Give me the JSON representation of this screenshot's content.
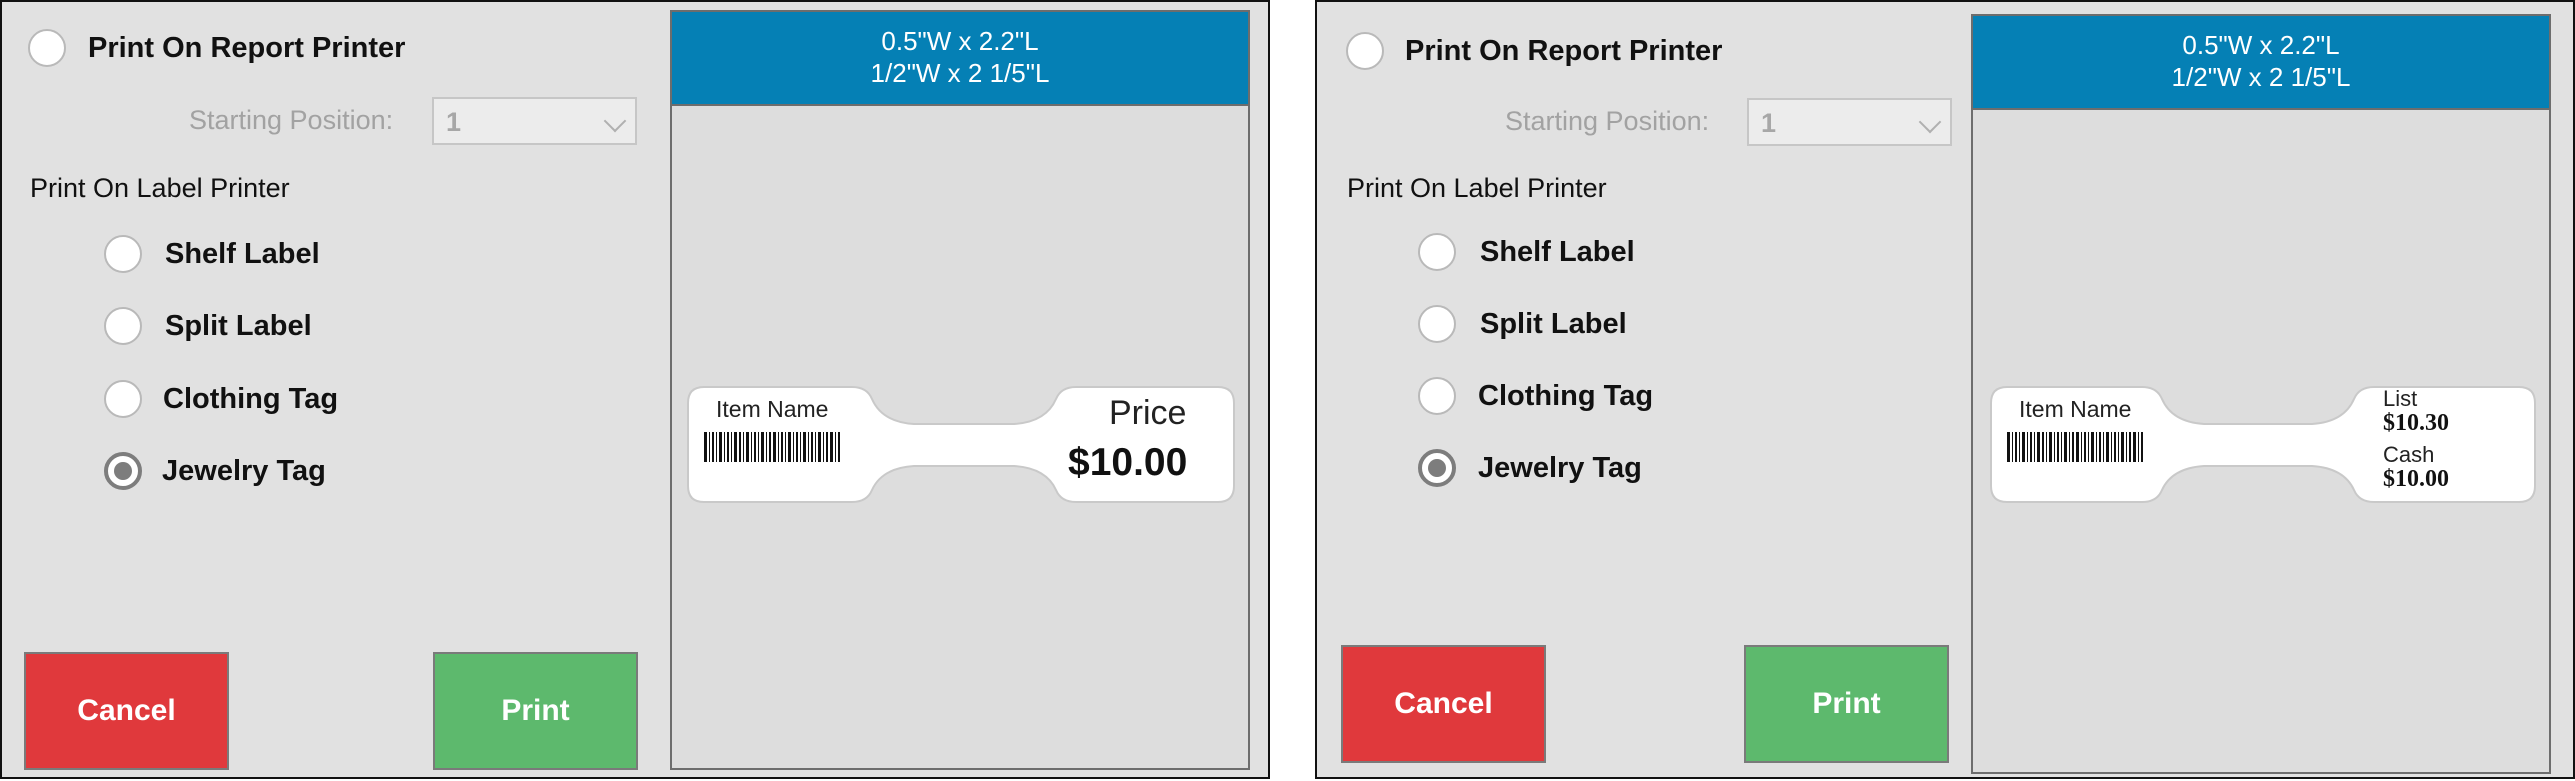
{
  "panels": [
    {
      "report_printer_label": "Print On Report Printer",
      "starting_position_label": "Starting Position:",
      "starting_position_value": "1",
      "label_printer_heading": "Print On Label Printer",
      "options": [
        {
          "label": "Shelf Label",
          "checked": false
        },
        {
          "label": "Split Label",
          "checked": false
        },
        {
          "label": "Clothing Tag",
          "checked": false
        },
        {
          "label": "Jewelry Tag",
          "checked": true
        }
      ],
      "cancel_label": "Cancel",
      "print_label": "Print",
      "preview": {
        "size_line1": "0.5\"W x 2.2\"L",
        "size_line2": "1/2\"W x 2 1/5\"L",
        "item_name": "Item Name",
        "price_label": "Price",
        "price_value": "$10.00"
      }
    },
    {
      "report_printer_label": "Print On Report Printer",
      "starting_position_label": "Starting Position:",
      "starting_position_value": "1",
      "label_printer_heading": "Print On Label Printer",
      "options": [
        {
          "label": "Shelf Label",
          "checked": false
        },
        {
          "label": "Split Label",
          "checked": false
        },
        {
          "label": "Clothing Tag",
          "checked": false
        },
        {
          "label": "Jewelry Tag",
          "checked": true
        }
      ],
      "cancel_label": "Cancel",
      "print_label": "Print",
      "preview": {
        "size_line1": "0.5\"W x 2.2\"L",
        "size_line2": "1/2\"W x 2 1/5\"L",
        "item_name": "Item Name",
        "list_label": "List",
        "list_value": "$10.30",
        "cash_label": "Cash",
        "cash_value": "$10.00"
      }
    }
  ]
}
